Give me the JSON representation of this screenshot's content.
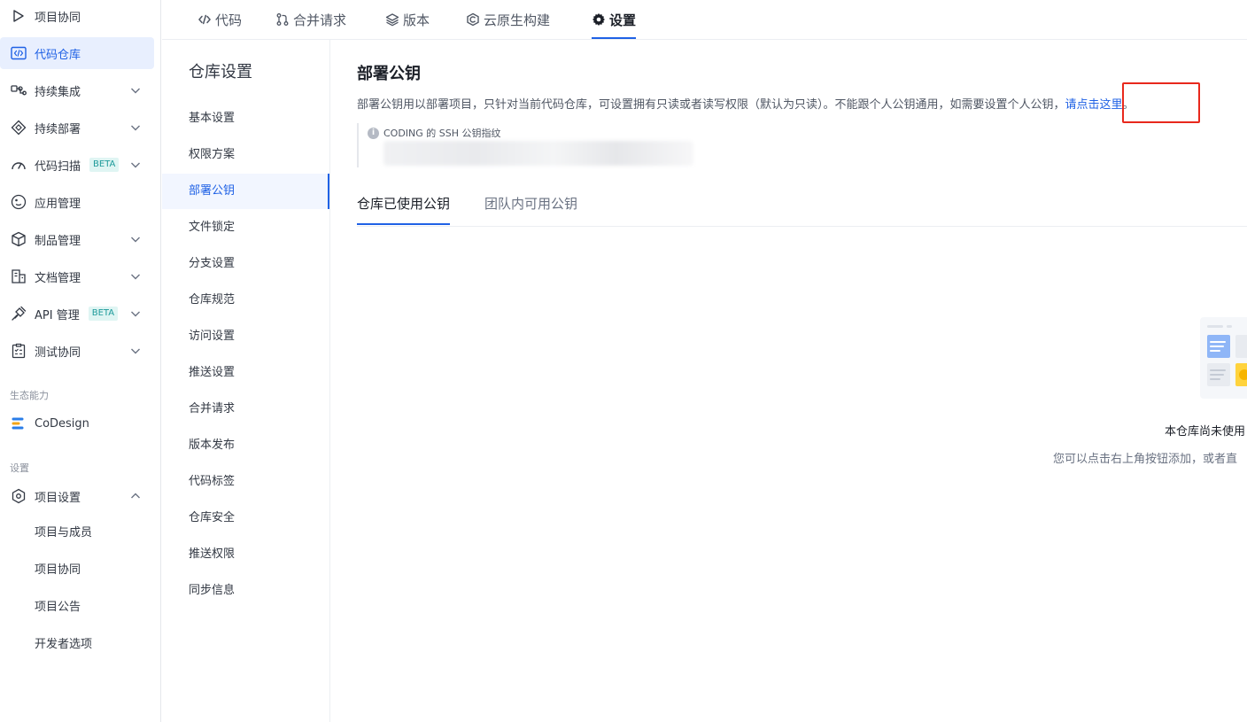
{
  "nav": {
    "items": [
      {
        "label": "项目协同",
        "icon": "play-triangle-icon",
        "has_chevron": false,
        "active": false
      },
      {
        "label": "代码仓库",
        "icon": "code-window-icon",
        "has_chevron": false,
        "active": true
      },
      {
        "label": "持续集成",
        "icon": "pipeline-icon",
        "has_chevron": true
      },
      {
        "label": "持续部署",
        "icon": "deploy-icon",
        "has_chevron": true
      },
      {
        "label": "代码扫描",
        "icon": "gauge-icon",
        "has_chevron": true,
        "badge": "BETA"
      },
      {
        "label": "应用管理",
        "icon": "app-circle-icon",
        "has_chevron": false
      },
      {
        "label": "制品管理",
        "icon": "cube-icon",
        "has_chevron": true
      },
      {
        "label": "文档管理",
        "icon": "document-icon",
        "has_chevron": true
      },
      {
        "label": "API 管理",
        "icon": "plug-icon",
        "has_chevron": true,
        "badge": "BETA"
      },
      {
        "label": "测试协同",
        "icon": "checklist-icon",
        "has_chevron": true
      }
    ],
    "ecosystem_section": "生态能力",
    "codesign": "CoDesign",
    "settings_section": "设置",
    "project_settings": "项目设置",
    "project_settings_children": [
      "项目与成员",
      "项目协同",
      "项目公告",
      "开发者选项"
    ]
  },
  "top_tabs": [
    {
      "label": "代码",
      "icon": "code-brackets-icon",
      "active": false
    },
    {
      "label": "合并请求",
      "icon": "merge-request-icon",
      "active": false
    },
    {
      "label": "版本",
      "icon": "layers-icon",
      "active": false
    },
    {
      "label": "云原生构建",
      "icon": "cloud-build-icon",
      "active": false
    },
    {
      "label": "设置",
      "icon": "gear-icon",
      "active": true
    }
  ],
  "settings_menu": {
    "title": "仓库设置",
    "items": [
      "基本设置",
      "权限方案",
      "部署公钥",
      "文件锁定",
      "分支设置",
      "仓库规范",
      "访问设置",
      "推送设置",
      "合并请求",
      "版本发布",
      "代码标签",
      "仓库安全",
      "推送权限",
      "同步信息"
    ],
    "active_index": 2
  },
  "main": {
    "title": "部署公钥",
    "description": "部署公钥用以部署项目，只针对当前代码仓库，可设置拥有只读或者读写权限（默认为只读）。不能跟个人公钥通用，如需要设置个人公钥，",
    "link_text": "请点击这里",
    "description_end": "。",
    "fingerprint_label": "CODING 的 SSH 公钥指纹",
    "tabs": [
      {
        "label": "仓库已使用公钥",
        "active": true
      },
      {
        "label": "团队内可用公钥",
        "active": false
      }
    ],
    "empty_title": "本仓库尚未使用",
    "empty_subtitle": "您可以点击右上角按钮添加，或者直"
  },
  "colors": {
    "accent": "#1f61e5",
    "highlight_box": "#e8281c",
    "beta_text": "#1d9a9a"
  }
}
